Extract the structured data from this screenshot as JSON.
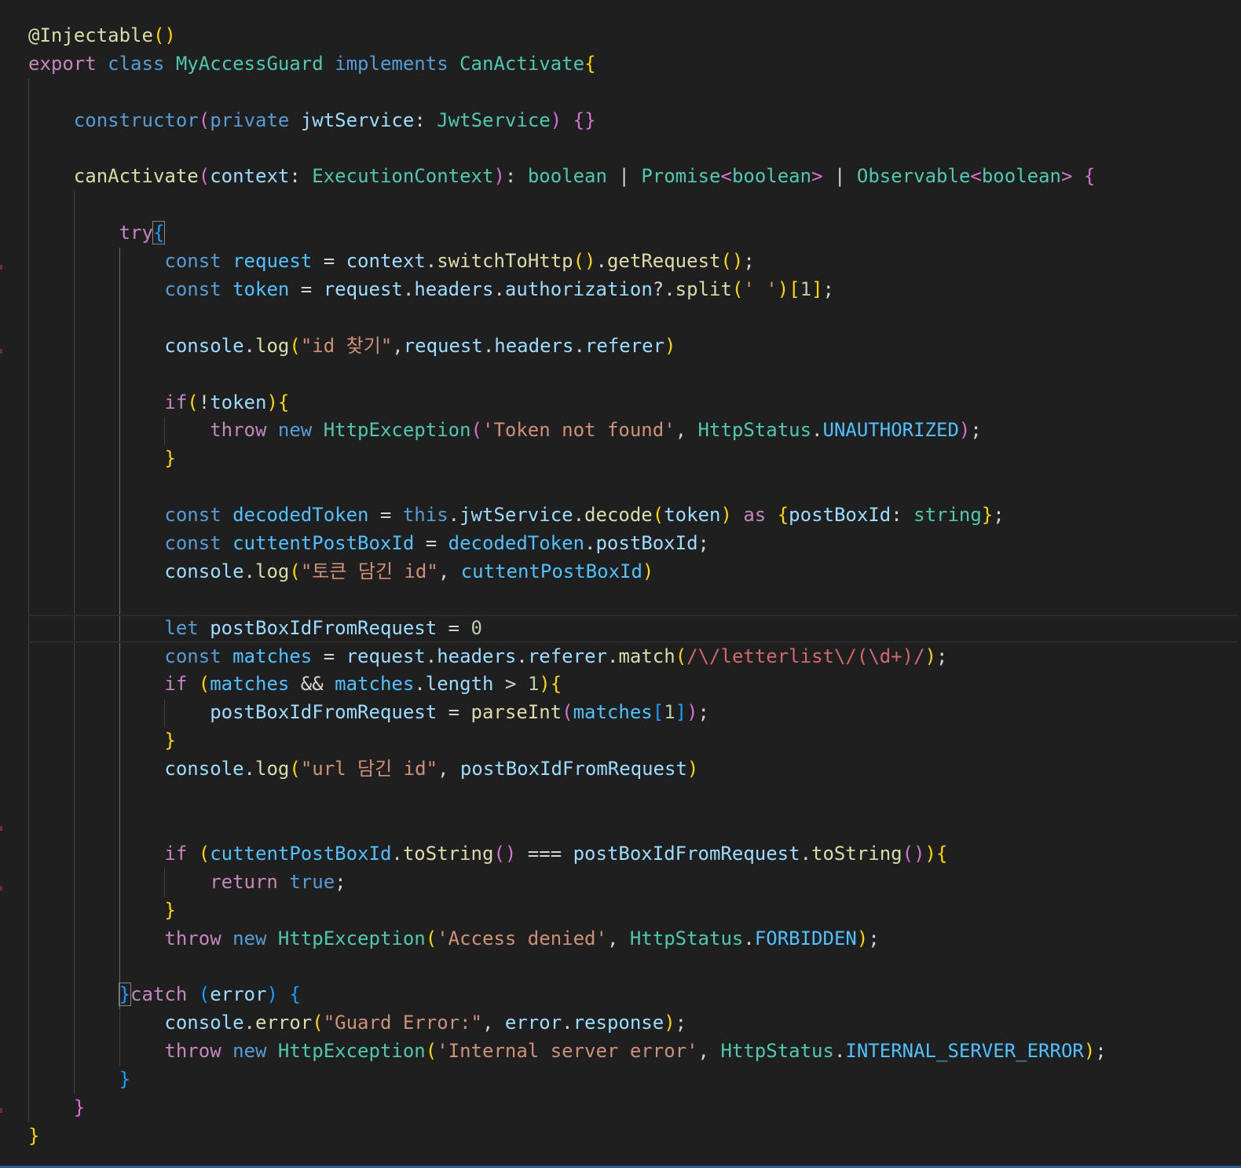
{
  "editor": {
    "language": "typescript",
    "lines": [
      [
        [
          "t-fn",
          "@Injectable"
        ],
        [
          "t-b1",
          "()"
        ]
      ],
      [
        [
          "k-ctrl",
          "export"
        ],
        [
          "t-plain",
          " "
        ],
        [
          "k-store",
          "class"
        ],
        [
          "t-plain",
          " "
        ],
        [
          "t-type",
          "MyAccessGuard"
        ],
        [
          "t-plain",
          " "
        ],
        [
          "k-store",
          "implements"
        ],
        [
          "t-plain",
          " "
        ],
        [
          "t-type",
          "CanActivate"
        ],
        [
          "t-b1",
          "{"
        ]
      ],
      [],
      [
        [
          "t-plain",
          "    "
        ],
        [
          "k-store",
          "constructor"
        ],
        [
          "t-b2",
          "("
        ],
        [
          "k-store",
          "private"
        ],
        [
          "t-plain",
          " "
        ],
        [
          "t-var",
          "jwtService"
        ],
        [
          "t-op",
          ": "
        ],
        [
          "t-type",
          "JwtService"
        ],
        [
          "t-b2",
          ")"
        ],
        [
          "t-plain",
          " "
        ],
        [
          "t-b2",
          "{}"
        ]
      ],
      [],
      [
        [
          "t-plain",
          "    "
        ],
        [
          "t-fn",
          "canActivate"
        ],
        [
          "t-b2",
          "("
        ],
        [
          "t-var",
          "context"
        ],
        [
          "t-op",
          ": "
        ],
        [
          "t-type",
          "ExecutionContext"
        ],
        [
          "t-b2",
          ")"
        ],
        [
          "t-op",
          ": "
        ],
        [
          "t-type",
          "boolean"
        ],
        [
          "t-op",
          " | "
        ],
        [
          "t-type",
          "Promise"
        ],
        [
          "t-b2",
          "<"
        ],
        [
          "t-type",
          "boolean"
        ],
        [
          "t-b2",
          ">"
        ],
        [
          "t-op",
          " | "
        ],
        [
          "t-type",
          "Observable"
        ],
        [
          "t-b2",
          "<"
        ],
        [
          "t-type",
          "boolean"
        ],
        [
          "t-b2",
          ">"
        ],
        [
          "t-plain",
          " "
        ],
        [
          "t-b2",
          "{"
        ]
      ],
      [],
      [
        [
          "t-plain",
          "        "
        ],
        [
          "k-ctrl",
          "try"
        ],
        [
          "t-b3 match-br",
          "{"
        ]
      ],
      [
        [
          "t-plain",
          "            "
        ],
        [
          "k-store",
          "const"
        ],
        [
          "t-plain",
          " "
        ],
        [
          "t-const",
          "request"
        ],
        [
          "t-op",
          " = "
        ],
        [
          "t-var",
          "context"
        ],
        [
          "t-op",
          "."
        ],
        [
          "t-fn",
          "switchToHttp"
        ],
        [
          "t-b1",
          "()"
        ],
        [
          "t-op",
          "."
        ],
        [
          "t-fn",
          "getRequest"
        ],
        [
          "t-b1",
          "()"
        ],
        [
          "t-op",
          ";"
        ]
      ],
      [
        [
          "t-plain",
          "            "
        ],
        [
          "k-store",
          "const"
        ],
        [
          "t-plain",
          " "
        ],
        [
          "t-const",
          "token"
        ],
        [
          "t-op",
          " = "
        ],
        [
          "t-var",
          "request"
        ],
        [
          "t-op",
          "."
        ],
        [
          "t-var",
          "headers"
        ],
        [
          "t-op",
          "."
        ],
        [
          "t-var",
          "authorization"
        ],
        [
          "t-op",
          "?."
        ],
        [
          "t-fn",
          "split"
        ],
        [
          "t-b1",
          "("
        ],
        [
          "t-str",
          "' '"
        ],
        [
          "t-b1",
          ")"
        ],
        [
          "t-b1",
          "["
        ],
        [
          "t-num",
          "1"
        ],
        [
          "t-b1",
          "]"
        ],
        [
          "t-op",
          ";"
        ]
      ],
      [],
      [
        [
          "t-plain",
          "            "
        ],
        [
          "t-var",
          "console"
        ],
        [
          "t-op",
          "."
        ],
        [
          "t-fn",
          "log"
        ],
        [
          "t-b1",
          "("
        ],
        [
          "t-str",
          "\"id 찾기\""
        ],
        [
          "t-op",
          ","
        ],
        [
          "t-var",
          "request"
        ],
        [
          "t-op",
          "."
        ],
        [
          "t-var",
          "headers"
        ],
        [
          "t-op",
          "."
        ],
        [
          "t-var",
          "referer"
        ],
        [
          "t-b1",
          ")"
        ]
      ],
      [],
      [
        [
          "t-plain",
          "            "
        ],
        [
          "k-ctrl",
          "if"
        ],
        [
          "t-b1",
          "("
        ],
        [
          "t-op",
          "!"
        ],
        [
          "t-var",
          "token"
        ],
        [
          "t-b1",
          ")"
        ],
        [
          "t-b1",
          "{"
        ]
      ],
      [
        [
          "t-plain",
          "                "
        ],
        [
          "k-ctrl",
          "throw"
        ],
        [
          "t-plain",
          " "
        ],
        [
          "k-store",
          "new"
        ],
        [
          "t-plain",
          " "
        ],
        [
          "t-type",
          "HttpException"
        ],
        [
          "t-b2",
          "("
        ],
        [
          "t-str",
          "'Token not found'"
        ],
        [
          "t-op",
          ", "
        ],
        [
          "t-type",
          "HttpStatus"
        ],
        [
          "t-op",
          "."
        ],
        [
          "t-const",
          "UNAUTHORIZED"
        ],
        [
          "t-b2",
          ")"
        ],
        [
          "t-op",
          ";"
        ]
      ],
      [
        [
          "t-plain",
          "            "
        ],
        [
          "t-b1",
          "}"
        ]
      ],
      [],
      [
        [
          "t-plain",
          "            "
        ],
        [
          "k-store",
          "const"
        ],
        [
          "t-plain",
          " "
        ],
        [
          "t-const",
          "decodedToken"
        ],
        [
          "t-op",
          " = "
        ],
        [
          "k-store",
          "this"
        ],
        [
          "t-op",
          "."
        ],
        [
          "t-var",
          "jwtService"
        ],
        [
          "t-op",
          "."
        ],
        [
          "t-fn",
          "decode"
        ],
        [
          "t-b1",
          "("
        ],
        [
          "t-var",
          "token"
        ],
        [
          "t-b1",
          ")"
        ],
        [
          "t-plain",
          " "
        ],
        [
          "k-ctrl",
          "as"
        ],
        [
          "t-plain",
          " "
        ],
        [
          "t-b1",
          "{"
        ],
        [
          "t-var",
          "postBoxId"
        ],
        [
          "t-op",
          ": "
        ],
        [
          "t-type",
          "string"
        ],
        [
          "t-b1",
          "}"
        ],
        [
          "t-op",
          ";"
        ]
      ],
      [
        [
          "t-plain",
          "            "
        ],
        [
          "k-store",
          "const"
        ],
        [
          "t-plain",
          " "
        ],
        [
          "t-const",
          "cuttentPostBoxId"
        ],
        [
          "t-op",
          " = "
        ],
        [
          "t-const",
          "decodedToken"
        ],
        [
          "t-op",
          "."
        ],
        [
          "t-var",
          "postBoxId"
        ],
        [
          "t-op",
          ";"
        ]
      ],
      [
        [
          "t-plain",
          "            "
        ],
        [
          "t-var",
          "console"
        ],
        [
          "t-op",
          "."
        ],
        [
          "t-fn",
          "log"
        ],
        [
          "t-b1",
          "("
        ],
        [
          "t-str",
          "\"토큰 담긴 id\""
        ],
        [
          "t-op",
          ", "
        ],
        [
          "t-const",
          "cuttentPostBoxId"
        ],
        [
          "t-b1",
          ")"
        ]
      ],
      [],
      [
        [
          "t-plain",
          "            "
        ],
        [
          "k-store",
          "let"
        ],
        [
          "t-plain",
          " "
        ],
        [
          "t-var",
          "postBoxIdFromRequest"
        ],
        [
          "t-op",
          " = "
        ],
        [
          "t-num",
          "0"
        ]
      ],
      [
        [
          "t-plain",
          "            "
        ],
        [
          "k-store",
          "const"
        ],
        [
          "t-plain",
          " "
        ],
        [
          "t-const",
          "matches"
        ],
        [
          "t-op",
          " = "
        ],
        [
          "t-var",
          "request"
        ],
        [
          "t-op",
          "."
        ],
        [
          "t-var",
          "headers"
        ],
        [
          "t-op",
          "."
        ],
        [
          "t-var",
          "referer"
        ],
        [
          "t-op",
          "."
        ],
        [
          "t-fn",
          "match"
        ],
        [
          "t-b1",
          "("
        ],
        [
          "t-rx",
          "/\\/letterlist\\/(\\d+)/"
        ],
        [
          "t-b1",
          ")"
        ],
        [
          "t-op",
          ";"
        ]
      ],
      [
        [
          "t-plain",
          "            "
        ],
        [
          "k-ctrl",
          "if"
        ],
        [
          "t-plain",
          " "
        ],
        [
          "t-b1",
          "("
        ],
        [
          "t-const",
          "matches"
        ],
        [
          "t-op",
          " && "
        ],
        [
          "t-const",
          "matches"
        ],
        [
          "t-op",
          "."
        ],
        [
          "t-var",
          "length"
        ],
        [
          "t-op",
          " > "
        ],
        [
          "t-num",
          "1"
        ],
        [
          "t-b1",
          ")"
        ],
        [
          "t-b1",
          "{"
        ]
      ],
      [
        [
          "t-plain",
          "                "
        ],
        [
          "t-var",
          "postBoxIdFromRequest"
        ],
        [
          "t-op",
          " = "
        ],
        [
          "t-fn",
          "parseInt"
        ],
        [
          "t-b2",
          "("
        ],
        [
          "t-const",
          "matches"
        ],
        [
          "t-b3",
          "["
        ],
        [
          "t-num",
          "1"
        ],
        [
          "t-b3",
          "]"
        ],
        [
          "t-b2",
          ")"
        ],
        [
          "t-op",
          ";"
        ]
      ],
      [
        [
          "t-plain",
          "            "
        ],
        [
          "t-b1",
          "}"
        ]
      ],
      [
        [
          "t-plain",
          "            "
        ],
        [
          "t-var",
          "console"
        ],
        [
          "t-op",
          "."
        ],
        [
          "t-fn",
          "log"
        ],
        [
          "t-b1",
          "("
        ],
        [
          "t-str",
          "\"url 담긴 id\""
        ],
        [
          "t-op",
          ", "
        ],
        [
          "t-var",
          "postBoxIdFromRequest"
        ],
        [
          "t-b1",
          ")"
        ]
      ],
      [],
      [],
      [
        [
          "t-plain",
          "            "
        ],
        [
          "k-ctrl",
          "if"
        ],
        [
          "t-plain",
          " "
        ],
        [
          "t-b1",
          "("
        ],
        [
          "t-const",
          "cuttentPostBoxId"
        ],
        [
          "t-op",
          "."
        ],
        [
          "t-fn",
          "toString"
        ],
        [
          "t-b2",
          "()"
        ],
        [
          "t-op",
          " === "
        ],
        [
          "t-var",
          "postBoxIdFromRequest"
        ],
        [
          "t-op",
          "."
        ],
        [
          "t-fn",
          "toString"
        ],
        [
          "t-b2",
          "()"
        ],
        [
          "t-b1",
          ")"
        ],
        [
          "t-b1",
          "{"
        ]
      ],
      [
        [
          "t-plain",
          "                "
        ],
        [
          "k-ctrl",
          "return"
        ],
        [
          "t-plain",
          " "
        ],
        [
          "k-store",
          "true"
        ],
        [
          "t-op",
          ";"
        ]
      ],
      [
        [
          "t-plain",
          "            "
        ],
        [
          "t-b1",
          "}"
        ]
      ],
      [
        [
          "t-plain",
          "            "
        ],
        [
          "k-ctrl",
          "throw"
        ],
        [
          "t-plain",
          " "
        ],
        [
          "k-store",
          "new"
        ],
        [
          "t-plain",
          " "
        ],
        [
          "t-type",
          "HttpException"
        ],
        [
          "t-b1",
          "("
        ],
        [
          "t-str",
          "'Access denied'"
        ],
        [
          "t-op",
          ", "
        ],
        [
          "t-type",
          "HttpStatus"
        ],
        [
          "t-op",
          "."
        ],
        [
          "t-const",
          "FORBIDDEN"
        ],
        [
          "t-b1",
          ")"
        ],
        [
          "t-op",
          ";"
        ]
      ],
      [],
      [
        [
          "t-plain",
          "        "
        ],
        [
          "t-b3 match-br",
          "}"
        ],
        [
          "k-ctrl",
          "catch"
        ],
        [
          "t-plain",
          " "
        ],
        [
          "t-b3",
          "("
        ],
        [
          "t-var",
          "error"
        ],
        [
          "t-b3",
          ")"
        ],
        [
          "t-plain",
          " "
        ],
        [
          "t-b3",
          "{"
        ]
      ],
      [
        [
          "t-plain",
          "            "
        ],
        [
          "t-var",
          "console"
        ],
        [
          "t-op",
          "."
        ],
        [
          "t-fn",
          "error"
        ],
        [
          "t-b1",
          "("
        ],
        [
          "t-str",
          "\"Guard Error:\""
        ],
        [
          "t-op",
          ", "
        ],
        [
          "t-var",
          "error"
        ],
        [
          "t-op",
          "."
        ],
        [
          "t-var",
          "response"
        ],
        [
          "t-b1",
          ")"
        ],
        [
          "t-op",
          ";"
        ]
      ],
      [
        [
          "t-plain",
          "            "
        ],
        [
          "k-ctrl",
          "throw"
        ],
        [
          "t-plain",
          " "
        ],
        [
          "k-store",
          "new"
        ],
        [
          "t-plain",
          " "
        ],
        [
          "t-type",
          "HttpException"
        ],
        [
          "t-b1",
          "("
        ],
        [
          "t-str",
          "'Internal server error'"
        ],
        [
          "t-op",
          ", "
        ],
        [
          "t-type",
          "HttpStatus"
        ],
        [
          "t-op",
          "."
        ],
        [
          "t-const",
          "INTERNAL_SERVER_ERROR"
        ],
        [
          "t-b1",
          ")"
        ],
        [
          "t-op",
          ";"
        ]
      ],
      [
        [
          "t-plain",
          "        "
        ],
        [
          "t-b3",
          "}"
        ]
      ],
      [
        [
          "t-plain",
          "    "
        ],
        [
          "t-b2",
          "}"
        ]
      ],
      [
        [
          "t-b1",
          "}"
        ]
      ]
    ],
    "current_line": 21
  }
}
